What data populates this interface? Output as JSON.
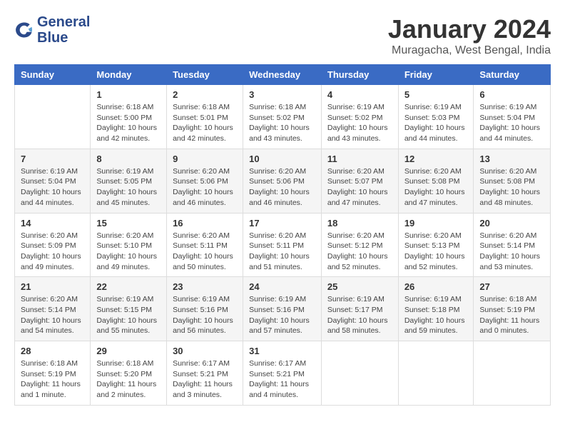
{
  "logo": {
    "line1": "General",
    "line2": "Blue"
  },
  "title": "January 2024",
  "subtitle": "Muragacha, West Bengal, India",
  "weekdays": [
    "Sunday",
    "Monday",
    "Tuesday",
    "Wednesday",
    "Thursday",
    "Friday",
    "Saturday"
  ],
  "weeks": [
    [
      {
        "day": "",
        "detail": ""
      },
      {
        "day": "1",
        "detail": "Sunrise: 6:18 AM\nSunset: 5:00 PM\nDaylight: 10 hours\nand 42 minutes."
      },
      {
        "day": "2",
        "detail": "Sunrise: 6:18 AM\nSunset: 5:01 PM\nDaylight: 10 hours\nand 42 minutes."
      },
      {
        "day": "3",
        "detail": "Sunrise: 6:18 AM\nSunset: 5:02 PM\nDaylight: 10 hours\nand 43 minutes."
      },
      {
        "day": "4",
        "detail": "Sunrise: 6:19 AM\nSunset: 5:02 PM\nDaylight: 10 hours\nand 43 minutes."
      },
      {
        "day": "5",
        "detail": "Sunrise: 6:19 AM\nSunset: 5:03 PM\nDaylight: 10 hours\nand 44 minutes."
      },
      {
        "day": "6",
        "detail": "Sunrise: 6:19 AM\nSunset: 5:04 PM\nDaylight: 10 hours\nand 44 minutes."
      }
    ],
    [
      {
        "day": "7",
        "detail": "Sunrise: 6:19 AM\nSunset: 5:04 PM\nDaylight: 10 hours\nand 44 minutes."
      },
      {
        "day": "8",
        "detail": "Sunrise: 6:19 AM\nSunset: 5:05 PM\nDaylight: 10 hours\nand 45 minutes."
      },
      {
        "day": "9",
        "detail": "Sunrise: 6:20 AM\nSunset: 5:06 PM\nDaylight: 10 hours\nand 46 minutes."
      },
      {
        "day": "10",
        "detail": "Sunrise: 6:20 AM\nSunset: 5:06 PM\nDaylight: 10 hours\nand 46 minutes."
      },
      {
        "day": "11",
        "detail": "Sunrise: 6:20 AM\nSunset: 5:07 PM\nDaylight: 10 hours\nand 47 minutes."
      },
      {
        "day": "12",
        "detail": "Sunrise: 6:20 AM\nSunset: 5:08 PM\nDaylight: 10 hours\nand 47 minutes."
      },
      {
        "day": "13",
        "detail": "Sunrise: 6:20 AM\nSunset: 5:08 PM\nDaylight: 10 hours\nand 48 minutes."
      }
    ],
    [
      {
        "day": "14",
        "detail": "Sunrise: 6:20 AM\nSunset: 5:09 PM\nDaylight: 10 hours\nand 49 minutes."
      },
      {
        "day": "15",
        "detail": "Sunrise: 6:20 AM\nSunset: 5:10 PM\nDaylight: 10 hours\nand 49 minutes."
      },
      {
        "day": "16",
        "detail": "Sunrise: 6:20 AM\nSunset: 5:11 PM\nDaylight: 10 hours\nand 50 minutes."
      },
      {
        "day": "17",
        "detail": "Sunrise: 6:20 AM\nSunset: 5:11 PM\nDaylight: 10 hours\nand 51 minutes."
      },
      {
        "day": "18",
        "detail": "Sunrise: 6:20 AM\nSunset: 5:12 PM\nDaylight: 10 hours\nand 52 minutes."
      },
      {
        "day": "19",
        "detail": "Sunrise: 6:20 AM\nSunset: 5:13 PM\nDaylight: 10 hours\nand 52 minutes."
      },
      {
        "day": "20",
        "detail": "Sunrise: 6:20 AM\nSunset: 5:14 PM\nDaylight: 10 hours\nand 53 minutes."
      }
    ],
    [
      {
        "day": "21",
        "detail": "Sunrise: 6:20 AM\nSunset: 5:14 PM\nDaylight: 10 hours\nand 54 minutes."
      },
      {
        "day": "22",
        "detail": "Sunrise: 6:19 AM\nSunset: 5:15 PM\nDaylight: 10 hours\nand 55 minutes."
      },
      {
        "day": "23",
        "detail": "Sunrise: 6:19 AM\nSunset: 5:16 PM\nDaylight: 10 hours\nand 56 minutes."
      },
      {
        "day": "24",
        "detail": "Sunrise: 6:19 AM\nSunset: 5:16 PM\nDaylight: 10 hours\nand 57 minutes."
      },
      {
        "day": "25",
        "detail": "Sunrise: 6:19 AM\nSunset: 5:17 PM\nDaylight: 10 hours\nand 58 minutes."
      },
      {
        "day": "26",
        "detail": "Sunrise: 6:19 AM\nSunset: 5:18 PM\nDaylight: 10 hours\nand 59 minutes."
      },
      {
        "day": "27",
        "detail": "Sunrise: 6:18 AM\nSunset: 5:19 PM\nDaylight: 11 hours\nand 0 minutes."
      }
    ],
    [
      {
        "day": "28",
        "detail": "Sunrise: 6:18 AM\nSunset: 5:19 PM\nDaylight: 11 hours\nand 1 minute."
      },
      {
        "day": "29",
        "detail": "Sunrise: 6:18 AM\nSunset: 5:20 PM\nDaylight: 11 hours\nand 2 minutes."
      },
      {
        "day": "30",
        "detail": "Sunrise: 6:17 AM\nSunset: 5:21 PM\nDaylight: 11 hours\nand 3 minutes."
      },
      {
        "day": "31",
        "detail": "Sunrise: 6:17 AM\nSunset: 5:21 PM\nDaylight: 11 hours\nand 4 minutes."
      },
      {
        "day": "",
        "detail": ""
      },
      {
        "day": "",
        "detail": ""
      },
      {
        "day": "",
        "detail": ""
      }
    ]
  ]
}
